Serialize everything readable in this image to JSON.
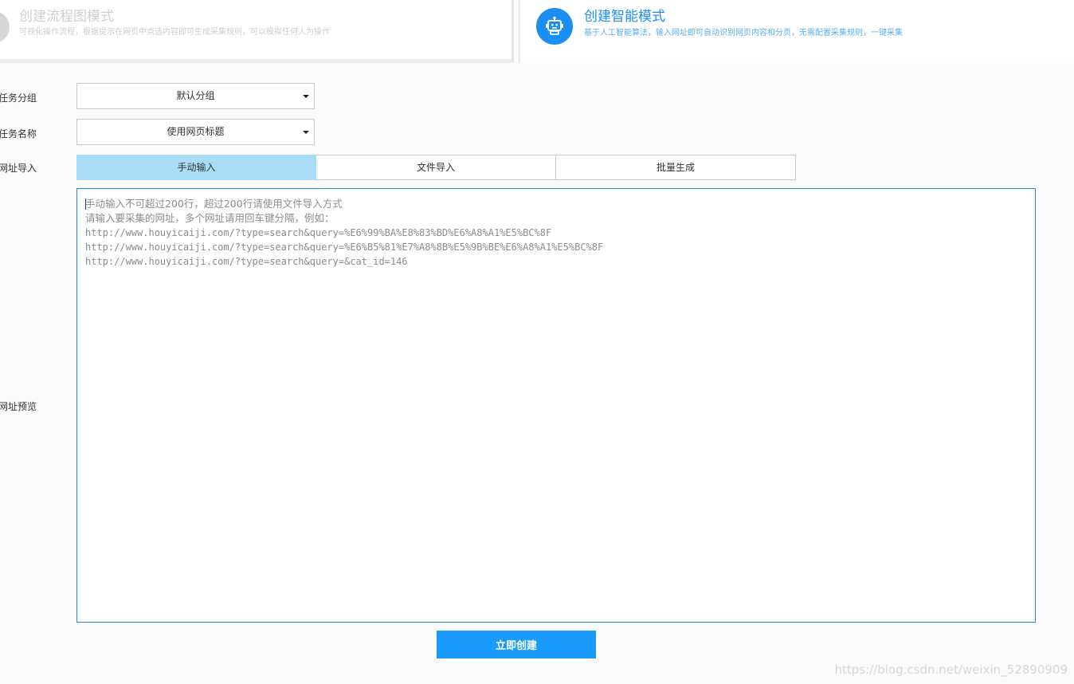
{
  "modes": {
    "flowchart": {
      "title": "创建流程图模式",
      "desc": "可视化操作流程，根据提示在网页中点选内容即可生成采集规则，可以模拟任何人为操作",
      "icon": "flowchart-icon"
    },
    "smart": {
      "title": "创建智能模式",
      "desc": "基于人工智能算法，输入网址即可自动识别网页内容和分页，无需配置采集规则，一键采集",
      "icon": "robot-icon",
      "active": true
    }
  },
  "form": {
    "group_label": "任务分组",
    "group_value": "默认分组",
    "name_label": "任务名称",
    "name_value": "使用网页标题",
    "import_label": "网址导入",
    "preview_label": "网址预览",
    "tabs": [
      {
        "label": "手动输入",
        "active": true
      },
      {
        "label": "文件导入",
        "active": false
      },
      {
        "label": "批量生成",
        "active": false
      }
    ],
    "placeholder_lines": [
      "手动输入不可超过200行，超过200行请使用文件导入方式",
      "请输入要采集的网址，多个网址请用回车键分隔，例如：",
      "http://www.houyicaiji.com/?type=search&query=%E6%99%BA%E8%83%BD%E6%A8%A1%E5%BC%8F",
      "http://www.houyicaiji.com/?type=search&query=%E6%B5%81%E7%A8%8B%E5%9B%BE%E6%A8%A1%E5%BC%8F",
      "http://www.houyicaiji.com/?type=search&query=&cat_id=146"
    ],
    "submit_label": "立即创建"
  },
  "watermark": "https://blog.csdn.net/weixin_52890909",
  "colors": {
    "accent": "#1a8ff3",
    "button": "#1a9bfb",
    "active_tab": "#a8dcf7",
    "input_border": "#2b86d6"
  }
}
